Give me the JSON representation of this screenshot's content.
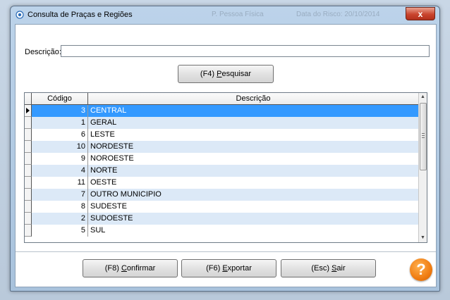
{
  "window": {
    "title": "Consulta de Praças e Regiões",
    "close_label": "x",
    "ghost_texts": [
      "P. Pessoa Física",
      "Data do Risco: 20/10/2014"
    ]
  },
  "form": {
    "description_label": "Descrição:",
    "description_value": "",
    "search_button": {
      "prefix": "(F4) ",
      "accel": "P",
      "rest": "esquisar"
    }
  },
  "grid": {
    "columns": [
      "Código",
      "Descrição"
    ],
    "selected_index": 0,
    "rows": [
      {
        "code": "3",
        "desc": "CENTRAL"
      },
      {
        "code": "1",
        "desc": "GERAL"
      },
      {
        "code": "6",
        "desc": "LESTE"
      },
      {
        "code": "10",
        "desc": "NORDESTE"
      },
      {
        "code": "9",
        "desc": "NOROESTE"
      },
      {
        "code": "4",
        "desc": "NORTE"
      },
      {
        "code": "11",
        "desc": "OESTE"
      },
      {
        "code": "7",
        "desc": "OUTRO MUNICIPIO"
      },
      {
        "code": "8",
        "desc": "SUDESTE"
      },
      {
        "code": "2",
        "desc": "SUDOESTE"
      },
      {
        "code": "5",
        "desc": "SUL"
      }
    ]
  },
  "buttons": {
    "confirm": {
      "prefix": "(F8) ",
      "accel": "C",
      "rest": "onfirmar"
    },
    "export": {
      "prefix": "(F6) ",
      "accel": "E",
      "rest": "xportar"
    },
    "exit": {
      "prefix": "(Esc) ",
      "accel": "S",
      "rest": "air"
    },
    "help_label": "?"
  },
  "colors": {
    "selection": "#3399ff",
    "alt_row": "#dce9f7",
    "help": "#f07d12",
    "close": "#c9452e"
  }
}
